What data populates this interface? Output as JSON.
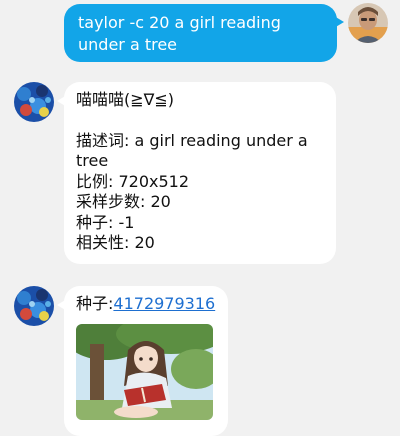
{
  "messages": [
    {
      "sender": "user",
      "text": "taylor -c 20 a girl reading under a tree"
    },
    {
      "sender": "bot",
      "title": "喵喵喵(≧∇≦)",
      "description_label": "描述词: a girl reading under a tree",
      "ratio_label": "比例: 720x512",
      "steps_label": "采样步数: 20",
      "seed_label": "种子: -1",
      "relevance_label": "相关性: 20"
    },
    {
      "sender": "bot",
      "seed_prefix": "种子:",
      "seed_value": "4172979316",
      "image_alt": "anime girl reading a red book under a tree"
    }
  ],
  "colors": {
    "background": "#f1f1f1",
    "outgoing_bubble": "#12a5e8",
    "incoming_bubble": "#ffffff",
    "link": "#1e6fd0"
  }
}
